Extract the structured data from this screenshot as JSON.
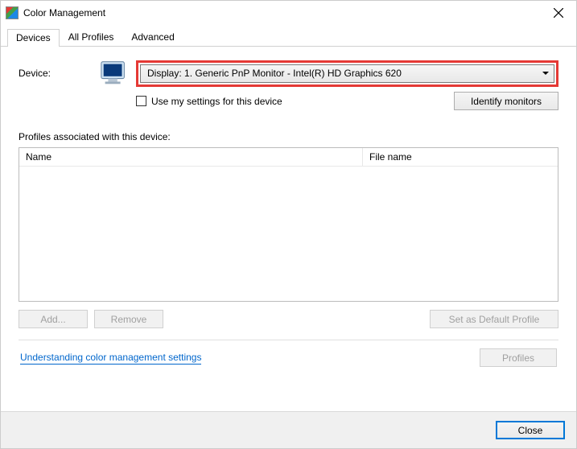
{
  "window": {
    "title": "Color Management"
  },
  "tabs": {
    "devices": "Devices",
    "all_profiles": "All Profiles",
    "advanced": "Advanced"
  },
  "device": {
    "label": "Device:",
    "selected": "Display: 1. Generic PnP Monitor - Intel(R) HD Graphics 620",
    "use_my_settings": "Use my settings for this device",
    "identify": "Identify monitors"
  },
  "profiles": {
    "header": "Profiles associated with this device:",
    "col_name": "Name",
    "col_file": "File name"
  },
  "buttons": {
    "add": "Add...",
    "remove": "Remove",
    "set_default": "Set as Default Profile",
    "profiles": "Profiles",
    "close": "Close"
  },
  "link": {
    "understanding": "Understanding color management settings"
  }
}
